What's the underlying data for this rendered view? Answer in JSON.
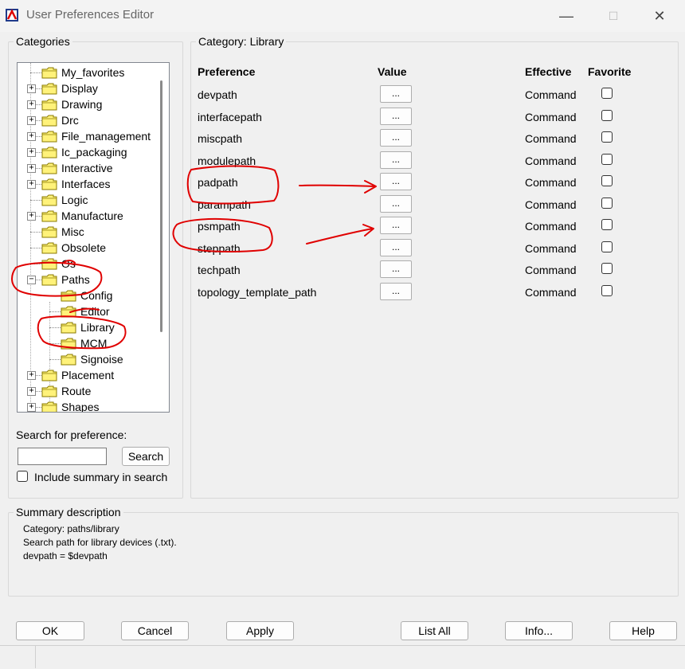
{
  "window": {
    "title": "User Preferences Editor",
    "controls": {
      "minimize": "—",
      "maximize": "☐",
      "close": "✕"
    }
  },
  "categories": {
    "label": "Categories",
    "tree": [
      {
        "label": "My_favorites",
        "indent": 0,
        "expander": "none"
      },
      {
        "label": "Display",
        "indent": 0,
        "expander": "+"
      },
      {
        "label": "Drawing",
        "indent": 0,
        "expander": "+"
      },
      {
        "label": "Drc",
        "indent": 0,
        "expander": "+"
      },
      {
        "label": "File_management",
        "indent": 0,
        "expander": "+"
      },
      {
        "label": "Ic_packaging",
        "indent": 0,
        "expander": "+"
      },
      {
        "label": "Interactive",
        "indent": 0,
        "expander": "+"
      },
      {
        "label": "Interfaces",
        "indent": 0,
        "expander": "+"
      },
      {
        "label": "Logic",
        "indent": 0,
        "expander": "none"
      },
      {
        "label": "Manufacture",
        "indent": 0,
        "expander": "+"
      },
      {
        "label": "Misc",
        "indent": 0,
        "expander": "none"
      },
      {
        "label": "Obsolete",
        "indent": 0,
        "expander": "none"
      },
      {
        "label": "Os",
        "indent": 0,
        "expander": "none"
      },
      {
        "label": "Paths",
        "indent": 0,
        "expander": "-"
      },
      {
        "label": "Config",
        "indent": 1,
        "expander": "none"
      },
      {
        "label": "Editor",
        "indent": 1,
        "expander": "none"
      },
      {
        "label": "Library",
        "indent": 1,
        "expander": "none"
      },
      {
        "label": "MCM",
        "indent": 1,
        "expander": "none"
      },
      {
        "label": "Signoise",
        "indent": 1,
        "expander": "none"
      },
      {
        "label": "Placement",
        "indent": 0,
        "expander": "+"
      },
      {
        "label": "Route",
        "indent": 0,
        "expander": "+"
      },
      {
        "label": "Shapes",
        "indent": 0,
        "expander": "+"
      }
    ]
  },
  "search": {
    "label": "Search for preference:",
    "value": "",
    "button": "Search",
    "include_summary_label": "Include summary in search",
    "include_summary_checked": false
  },
  "category_panel": {
    "label": "Category:  Library",
    "headers": {
      "preference": "Preference",
      "value": "Value",
      "effective": "Effective",
      "favorite": "Favorite"
    },
    "value_button_label": "...",
    "rows": [
      {
        "preference": "devpath",
        "effective": "Command",
        "favorite": false
      },
      {
        "preference": "interfacepath",
        "effective": "Command",
        "favorite": false
      },
      {
        "preference": "miscpath",
        "effective": "Command",
        "favorite": false
      },
      {
        "preference": "modulepath",
        "effective": "Command",
        "favorite": false
      },
      {
        "preference": "padpath",
        "effective": "Command",
        "favorite": false
      },
      {
        "preference": "parampath",
        "effective": "Command",
        "favorite": false
      },
      {
        "preference": "psmpath",
        "effective": "Command",
        "favorite": false
      },
      {
        "preference": "steppath",
        "effective": "Command",
        "favorite": false
      },
      {
        "preference": "techpath",
        "effective": "Command",
        "favorite": false
      },
      {
        "preference": "topology_template_path",
        "effective": "Command",
        "favorite": false
      }
    ]
  },
  "summary": {
    "label": "Summary description",
    "lines": [
      "Category: paths/library",
      "Search path for library devices (.txt).",
      "devpath = $devpath"
    ]
  },
  "buttons": {
    "ok": "OK",
    "cancel": "Cancel",
    "apply": "Apply",
    "list_all": "List All",
    "info": "Info...",
    "help": "Help"
  },
  "colors": {
    "annotation": "#e00000",
    "folder_fill": "#fff27a",
    "folder_stroke": "#8a7a00"
  }
}
